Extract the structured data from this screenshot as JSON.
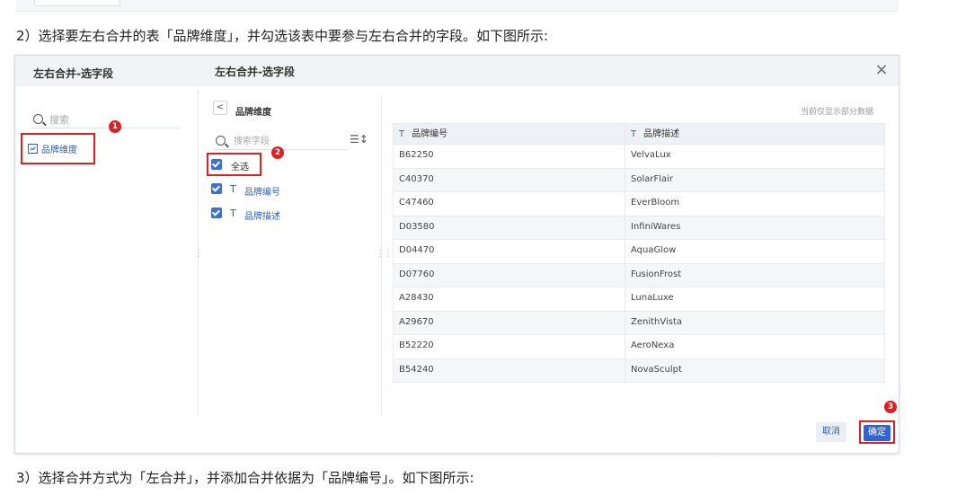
{
  "paragraph2": "2）选择要左右合并的表「品牌维度」，并勾选该表中要参与左右合并的字段。如下图所示:",
  "paragraph3": "3）选择合并方式为「左合并」，并添加合并依据为「品牌编号」。如下图所示:",
  "dialog": {
    "left_title": "左右合并-选字段",
    "title": "左右合并-选字段",
    "close": "×"
  },
  "left_panel": {
    "search_placeholder": "搜索",
    "table_item": "品牌维度"
  },
  "middle_panel": {
    "back": "<",
    "table_name": "品牌维度",
    "search_placeholder": "搜索字段",
    "select_all": "全选",
    "fields": [
      "品牌编号",
      "品牌描述"
    ],
    "field_type_icon": "T"
  },
  "preview": {
    "note": "当前仅显示部分数据",
    "columns": [
      "品牌编号",
      "品牌描述"
    ],
    "rows": [
      [
        "B62250",
        "VelvaLux"
      ],
      [
        "C40370",
        "SolarFlair"
      ],
      [
        "C47460",
        "EverBloom"
      ],
      [
        "D03580",
        "InfiniWares"
      ],
      [
        "D04470",
        "AquaGlow"
      ],
      [
        "D07760",
        "FusionFrost"
      ],
      [
        "A28430",
        "LunaLuxe"
      ],
      [
        "A29670",
        "ZenithVista"
      ],
      [
        "B52220",
        "AeroNexa"
      ],
      [
        "B54240",
        "NovaSculpt"
      ]
    ]
  },
  "buttons": {
    "cancel": "取消",
    "ok": "确定"
  },
  "badges": [
    "1",
    "2",
    "3"
  ],
  "colors": {
    "accent": "#2f64d6",
    "annotation_red": "#e02020"
  }
}
